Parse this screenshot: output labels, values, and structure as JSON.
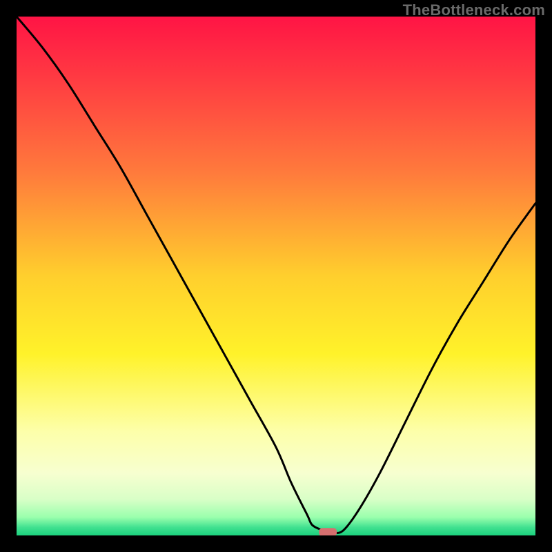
{
  "attribution": "TheBottleneck.com",
  "chart_data": {
    "type": "line",
    "title": "",
    "xlabel": "",
    "ylabel": "",
    "xlim": [
      0,
      100
    ],
    "ylim": [
      0,
      100
    ],
    "x": [
      0,
      5,
      10,
      15,
      20,
      25,
      30,
      35,
      40,
      45,
      50,
      53,
      56,
      57,
      59,
      61,
      63,
      66,
      70,
      75,
      80,
      85,
      90,
      95,
      100
    ],
    "values": [
      100,
      94,
      87,
      79,
      71,
      62,
      53,
      44,
      35,
      26,
      17,
      10,
      4,
      2,
      1,
      0.5,
      1,
      5,
      12,
      22,
      32,
      41,
      49,
      57,
      64
    ],
    "marker": {
      "x": 60,
      "y": 0.5,
      "shape": "rounded-rect",
      "color": "#d66f6f"
    },
    "gradient_stops": [
      {
        "offset": 0.0,
        "color": "#ff1445"
      },
      {
        "offset": 0.12,
        "color": "#ff3b42"
      },
      {
        "offset": 0.3,
        "color": "#ff7a3c"
      },
      {
        "offset": 0.5,
        "color": "#ffcf2d"
      },
      {
        "offset": 0.65,
        "color": "#fff22a"
      },
      {
        "offset": 0.8,
        "color": "#fdffaa"
      },
      {
        "offset": 0.88,
        "color": "#f7ffd0"
      },
      {
        "offset": 0.93,
        "color": "#d9ffc7"
      },
      {
        "offset": 0.965,
        "color": "#9affad"
      },
      {
        "offset": 0.985,
        "color": "#3fe08f"
      },
      {
        "offset": 1.0,
        "color": "#1bd17e"
      }
    ]
  }
}
